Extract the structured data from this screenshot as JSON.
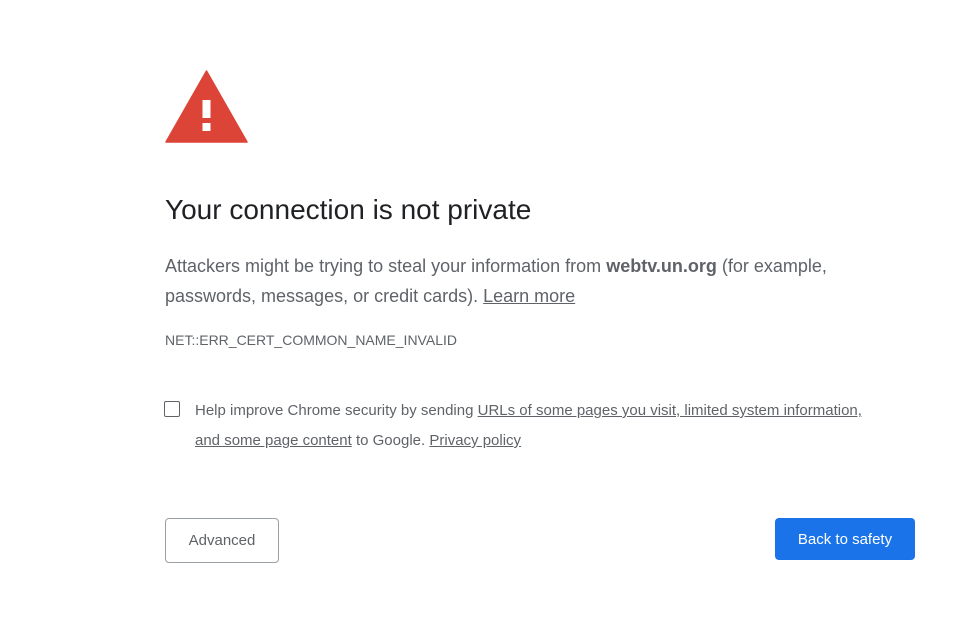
{
  "icon": {
    "name": "warning-triangle-icon",
    "color": "#db4437"
  },
  "heading": "Your connection is not private",
  "message": {
    "part1": "Attackers might be trying to steal your information from ",
    "domain": "webtv.un.org",
    "part2": " (for example, passwords, messages, or credit cards). ",
    "learn_more": "Learn more"
  },
  "error_code": "NET::ERR_CERT_COMMON_NAME_INVALID",
  "optin": {
    "checked": false,
    "prefix": "Help improve Chrome security by sending ",
    "link1": "URLs of some pages you visit, limited system information, and some page content",
    "middle": " to Google. ",
    "link2": "Privacy policy"
  },
  "buttons": {
    "advanced": "Advanced",
    "back_to_safety": "Back to safety"
  },
  "colors": {
    "primary_button": "#1a73e8",
    "heading_text": "#202124",
    "body_text": "#5f6368"
  }
}
